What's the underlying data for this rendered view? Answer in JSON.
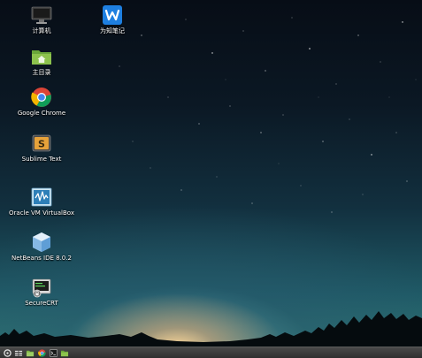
{
  "desktop": {
    "icons": [
      {
        "label": "计算机",
        "icon": "computer-icon"
      },
      {
        "label": "为知笔记",
        "icon": "wiznote-icon"
      },
      {
        "label": "主目录",
        "icon": "home-folder-icon"
      },
      {
        "label": "Google Chrome",
        "icon": "chrome-icon"
      },
      {
        "label": "Sublime Text",
        "icon": "sublime-text-icon"
      },
      {
        "label": "Oracle VM VirtualBox",
        "icon": "virtualbox-icon"
      },
      {
        "label": "NetBeans IDE 8.0.2",
        "icon": "netbeans-icon"
      },
      {
        "label": "SecureCRT",
        "icon": "securecrt-icon"
      }
    ]
  },
  "taskbar": {
    "items": [
      {
        "icon": "menu-icon"
      },
      {
        "icon": "show-desktop-icon"
      },
      {
        "icon": "file-manager-icon"
      },
      {
        "icon": "chrome-icon"
      },
      {
        "icon": "terminal-icon"
      },
      {
        "icon": "folder-icon"
      }
    ]
  },
  "colors": {
    "label_text": "#ffffff",
    "taskbar_bg": "#3a3a3a",
    "sky_top": "#070d16",
    "horizon_glow": "#ffd696"
  }
}
